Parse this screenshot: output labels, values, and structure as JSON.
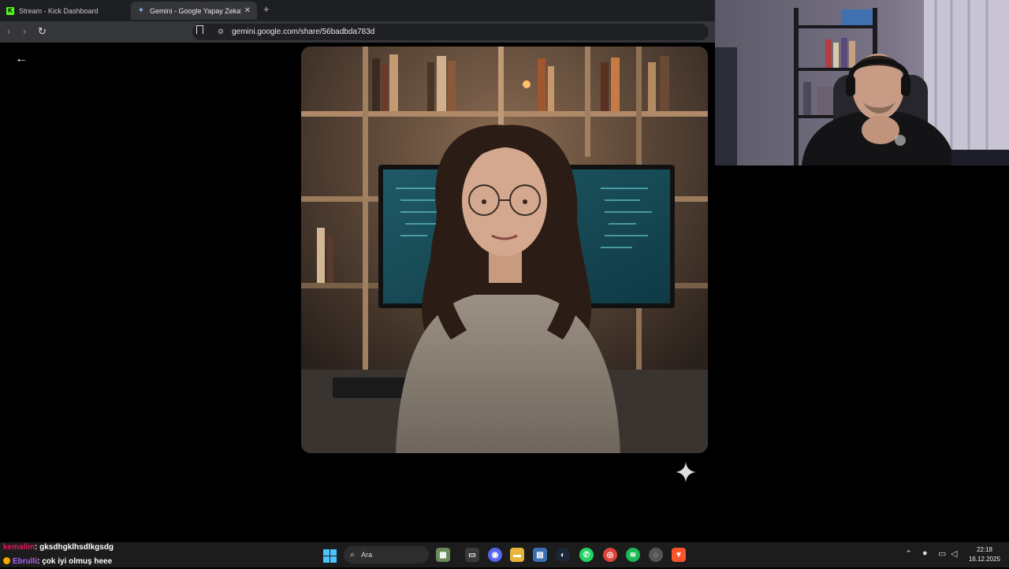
{
  "browser": {
    "tabs": [
      {
        "label": "Stream - Kick Dashboard",
        "active": false
      },
      {
        "label": "Gemini - Google Yapay Zeka'ya",
        "active": true
      }
    ],
    "url": "gemini.google.com/share/56badbda783d"
  },
  "taskbar": {
    "search_label": "Ara",
    "time": "22:18",
    "date": "16.12.2025"
  },
  "chat": [
    {
      "user": "kemalim",
      "message": ": gksdhgklhsdlkgsdg"
    },
    {
      "user": "Ebrulli",
      "message": ": çok iyi olmuş heee"
    }
  ],
  "colors": {
    "accent_windows": "#4cc2ff",
    "kick_green": "#53fc18",
    "chat_user1": "#e0195a",
    "chat_user2": "#b060ff"
  }
}
